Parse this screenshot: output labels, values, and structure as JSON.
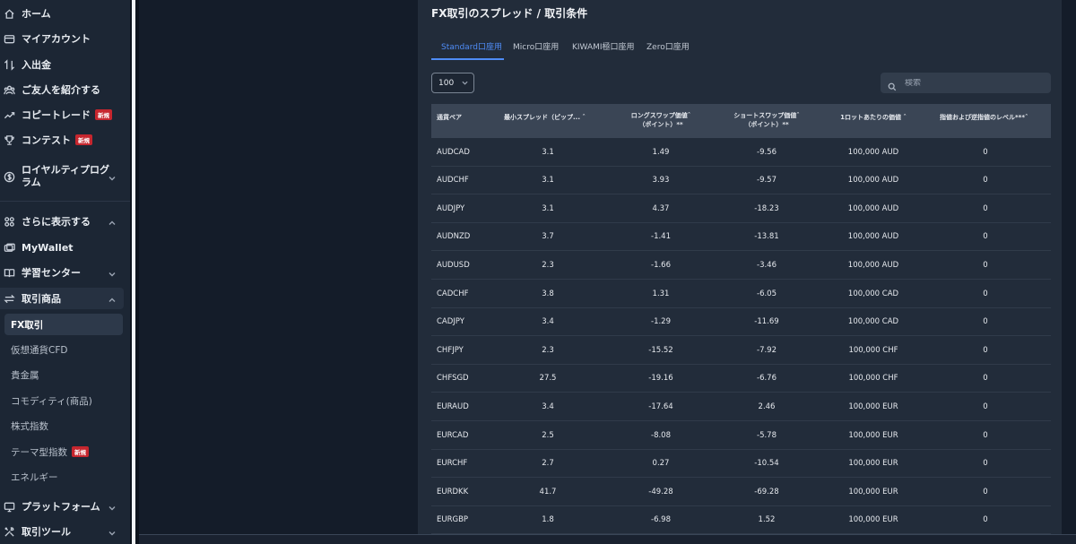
{
  "sidebar": {
    "items": [
      {
        "label": "ホーム",
        "icon": "home-icon"
      },
      {
        "label": "マイアカウント",
        "icon": "wallet-card-icon"
      },
      {
        "label": "入出金",
        "icon": "transfer-arrows-icon"
      },
      {
        "label": "ご友人を紹介する",
        "icon": "people-icon"
      },
      {
        "label": "コピートレード",
        "icon": "trend-up-icon",
        "badge": "新規"
      },
      {
        "label": "コンテスト",
        "icon": "trophy-icon",
        "badge": "新規"
      },
      {
        "label": "ロイヤルティプログラム",
        "label_line2": "ラム",
        "icon": "dollar-coin-icon"
      },
      {
        "label": "さらに表示する",
        "icon": "grid-icon"
      },
      {
        "label": "MyWallet",
        "icon": "mywallet-icon"
      },
      {
        "label": "学習センター",
        "icon": "book-icon"
      },
      {
        "label": "取引商品",
        "icon": "swap-icon"
      },
      {
        "label": "プラットフォーム",
        "icon": "monitor-icon"
      },
      {
        "label": "取引ツール",
        "icon": "tools-icon"
      }
    ],
    "loyalty_line1": "ロイヤルティプログ",
    "loyalty_line2": "ラム",
    "sub_items": [
      "FX取引",
      "仮想通貨CFD",
      "貴金属",
      "コモディティ(商品)",
      "株式指数",
      "テーマ型指数",
      "エネルギー"
    ],
    "theme_badge": "新規"
  },
  "page": {
    "title": "FX取引のスプレッド / 取引条件",
    "tabs": [
      "Standard口座用",
      "Micro口座用",
      "KIWAMI極口座用",
      "Zero口座用"
    ],
    "active_tab": "Standard口座用",
    "page_size": "100",
    "search_placeholder": "検索"
  },
  "table": {
    "headers": {
      "pair": "通貨ペア",
      "spread": "最小スプレッド（ピップ...",
      "long1": "ロングスワップ価値",
      "long2": "（ポイント）**",
      "short1": "ショートスワップ価値",
      "short2": "（ポイント）**",
      "lot": "1ロットあたりの価値",
      "level": "指値および逆指値のレベル***"
    },
    "rows": [
      [
        "AUDCAD",
        "3.1",
        "1.49",
        "-9.56",
        "100,000 AUD",
        "0"
      ],
      [
        "AUDCHF",
        "3.1",
        "3.93",
        "-9.57",
        "100,000 AUD",
        "0"
      ],
      [
        "AUDJPY",
        "3.1",
        "4.37",
        "-18.23",
        "100,000 AUD",
        "0"
      ],
      [
        "AUDNZD",
        "3.7",
        "-1.41",
        "-13.81",
        "100,000 AUD",
        "0"
      ],
      [
        "AUDUSD",
        "2.3",
        "-1.66",
        "-3.46",
        "100,000 AUD",
        "0"
      ],
      [
        "CADCHF",
        "3.8",
        "1.31",
        "-6.05",
        "100,000 CAD",
        "0"
      ],
      [
        "CADJPY",
        "3.4",
        "-1.29",
        "-11.69",
        "100,000 CAD",
        "0"
      ],
      [
        "CHFJPY",
        "2.3",
        "-15.52",
        "-7.92",
        "100,000 CHF",
        "0"
      ],
      [
        "CHFSGD",
        "27.5",
        "-19.16",
        "-6.76",
        "100,000 CHF",
        "0"
      ],
      [
        "EURAUD",
        "3.4",
        "-17.64",
        "2.46",
        "100,000 EUR",
        "0"
      ],
      [
        "EURCAD",
        "2.5",
        "-8.08",
        "-5.78",
        "100,000 EUR",
        "0"
      ],
      [
        "EURCHF",
        "2.7",
        "0.27",
        "-10.54",
        "100,000 EUR",
        "0"
      ],
      [
        "EURDKK",
        "41.7",
        "-49.28",
        "-69.28",
        "100,000 EUR",
        "0"
      ],
      [
        "EURGBP",
        "1.8",
        "-6.98",
        "1.52",
        "100,000 EUR",
        "0"
      ]
    ]
  },
  "colors": {
    "accent": "#4f8cf6",
    "badge": "#c6262e"
  }
}
